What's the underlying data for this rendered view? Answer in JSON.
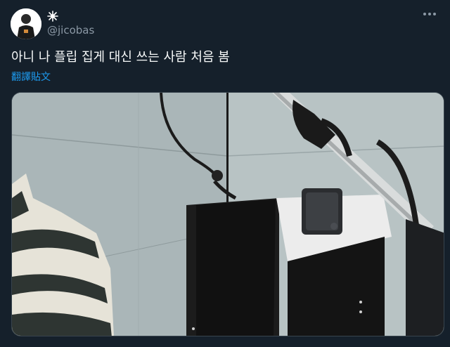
{
  "author": {
    "display_name_icon": "sparkle-icon",
    "handle": "@jicobas",
    "avatar_icon": "avatar-icon"
  },
  "tweet": {
    "text": "아니 나 플립 집게 대신 쓰는 사람 처음 봄",
    "translate_label": "翻譯貼文"
  },
  "menu": {
    "more_icon": "more-dots-icon"
  },
  "colors": {
    "background": "#15202b",
    "link": "#1d9bf0",
    "secondary_text": "#8b98a5"
  }
}
